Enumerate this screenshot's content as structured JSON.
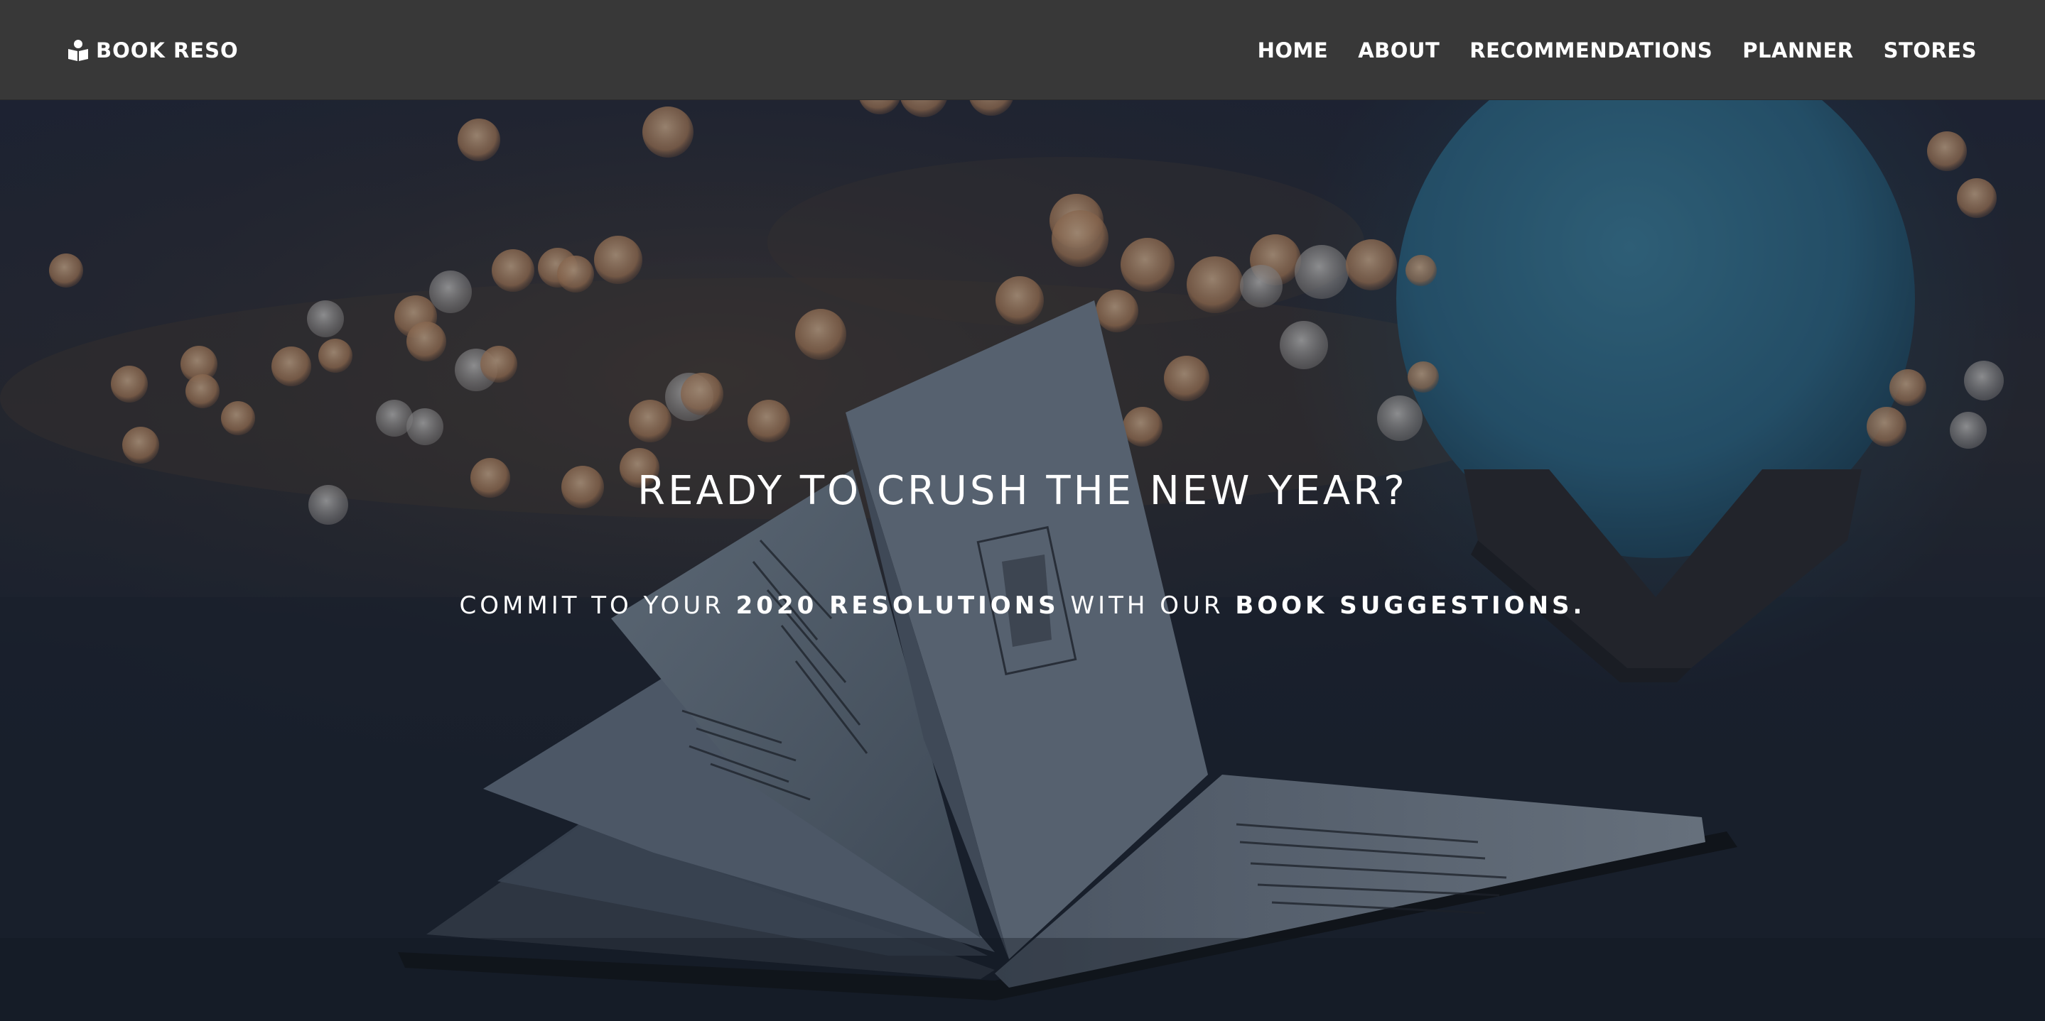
{
  "navbar": {
    "brand": "BOOK RESO",
    "brand_icon": "open-book-reader-icon",
    "links": [
      {
        "label": "HOME"
      },
      {
        "label": "ABOUT"
      },
      {
        "label": "RECOMMENDATIONS"
      },
      {
        "label": "PLANNER"
      },
      {
        "label": "STORES"
      }
    ],
    "background_color": "#383838"
  },
  "hero": {
    "title": "READY TO CRUSH THE NEW YEAR?",
    "subtitle": {
      "part1": "COMMIT TO YOUR ",
      "highlight1": "2020 RESOLUTIONS",
      "part2": " WITH OUR ",
      "highlight2": "BOOK SUGGESTIONS."
    },
    "background_description_icon": "book-bokeh-photo",
    "text_color": "#ffffff"
  }
}
